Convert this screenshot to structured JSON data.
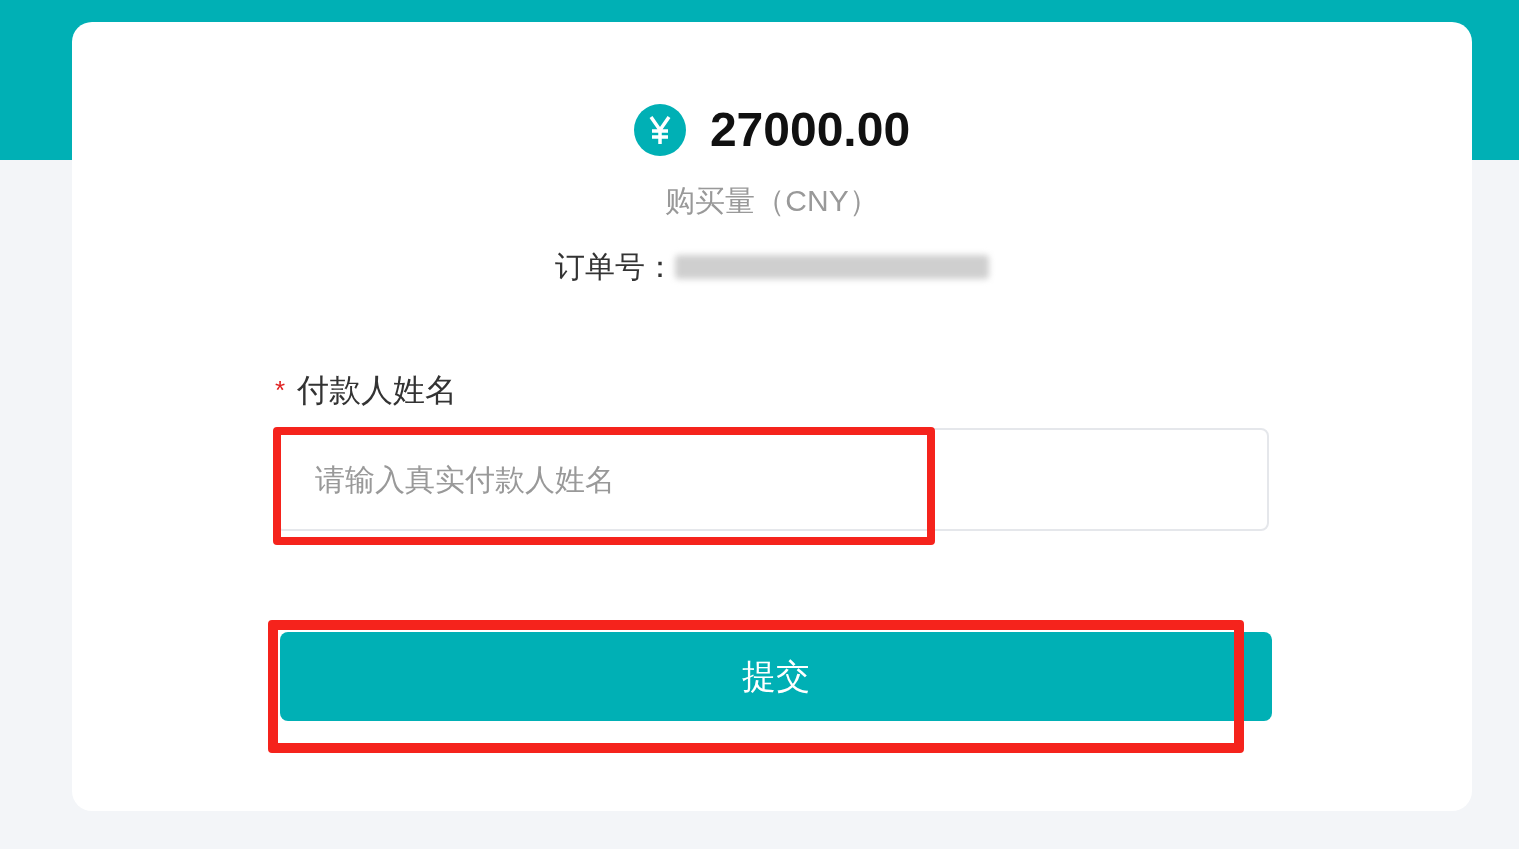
{
  "amount": {
    "value": "27000.00",
    "caption": "购买量（CNY）"
  },
  "order": {
    "label": "订单号：",
    "value_hidden": true
  },
  "payer_name": {
    "label": "付款人姓名",
    "required_mark": "*",
    "placeholder": "请输入真实付款人姓名",
    "highlighted": true
  },
  "submit": {
    "label": "提交",
    "highlighted": true
  }
}
